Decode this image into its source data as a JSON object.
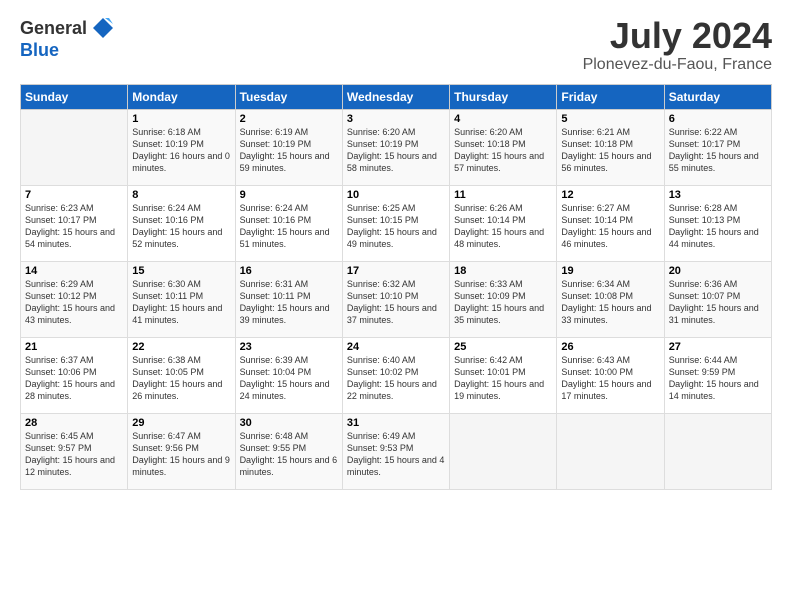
{
  "header": {
    "logo_general": "General",
    "logo_blue": "Blue",
    "month_title": "July 2024",
    "location": "Plonevez-du-Faou, France"
  },
  "days_of_week": [
    "Sunday",
    "Monday",
    "Tuesday",
    "Wednesday",
    "Thursday",
    "Friday",
    "Saturday"
  ],
  "weeks": [
    [
      {
        "num": "",
        "sunrise": "",
        "sunset": "",
        "daylight": ""
      },
      {
        "num": "1",
        "sunrise": "Sunrise: 6:18 AM",
        "sunset": "Sunset: 10:19 PM",
        "daylight": "Daylight: 16 hours and 0 minutes."
      },
      {
        "num": "2",
        "sunrise": "Sunrise: 6:19 AM",
        "sunset": "Sunset: 10:19 PM",
        "daylight": "Daylight: 15 hours and 59 minutes."
      },
      {
        "num": "3",
        "sunrise": "Sunrise: 6:20 AM",
        "sunset": "Sunset: 10:19 PM",
        "daylight": "Daylight: 15 hours and 58 minutes."
      },
      {
        "num": "4",
        "sunrise": "Sunrise: 6:20 AM",
        "sunset": "Sunset: 10:18 PM",
        "daylight": "Daylight: 15 hours and 57 minutes."
      },
      {
        "num": "5",
        "sunrise": "Sunrise: 6:21 AM",
        "sunset": "Sunset: 10:18 PM",
        "daylight": "Daylight: 15 hours and 56 minutes."
      },
      {
        "num": "6",
        "sunrise": "Sunrise: 6:22 AM",
        "sunset": "Sunset: 10:17 PM",
        "daylight": "Daylight: 15 hours and 55 minutes."
      }
    ],
    [
      {
        "num": "7",
        "sunrise": "Sunrise: 6:23 AM",
        "sunset": "Sunset: 10:17 PM",
        "daylight": "Daylight: 15 hours and 54 minutes."
      },
      {
        "num": "8",
        "sunrise": "Sunrise: 6:24 AM",
        "sunset": "Sunset: 10:16 PM",
        "daylight": "Daylight: 15 hours and 52 minutes."
      },
      {
        "num": "9",
        "sunrise": "Sunrise: 6:24 AM",
        "sunset": "Sunset: 10:16 PM",
        "daylight": "Daylight: 15 hours and 51 minutes."
      },
      {
        "num": "10",
        "sunrise": "Sunrise: 6:25 AM",
        "sunset": "Sunset: 10:15 PM",
        "daylight": "Daylight: 15 hours and 49 minutes."
      },
      {
        "num": "11",
        "sunrise": "Sunrise: 6:26 AM",
        "sunset": "Sunset: 10:14 PM",
        "daylight": "Daylight: 15 hours and 48 minutes."
      },
      {
        "num": "12",
        "sunrise": "Sunrise: 6:27 AM",
        "sunset": "Sunset: 10:14 PM",
        "daylight": "Daylight: 15 hours and 46 minutes."
      },
      {
        "num": "13",
        "sunrise": "Sunrise: 6:28 AM",
        "sunset": "Sunset: 10:13 PM",
        "daylight": "Daylight: 15 hours and 44 minutes."
      }
    ],
    [
      {
        "num": "14",
        "sunrise": "Sunrise: 6:29 AM",
        "sunset": "Sunset: 10:12 PM",
        "daylight": "Daylight: 15 hours and 43 minutes."
      },
      {
        "num": "15",
        "sunrise": "Sunrise: 6:30 AM",
        "sunset": "Sunset: 10:11 PM",
        "daylight": "Daylight: 15 hours and 41 minutes."
      },
      {
        "num": "16",
        "sunrise": "Sunrise: 6:31 AM",
        "sunset": "Sunset: 10:11 PM",
        "daylight": "Daylight: 15 hours and 39 minutes."
      },
      {
        "num": "17",
        "sunrise": "Sunrise: 6:32 AM",
        "sunset": "Sunset: 10:10 PM",
        "daylight": "Daylight: 15 hours and 37 minutes."
      },
      {
        "num": "18",
        "sunrise": "Sunrise: 6:33 AM",
        "sunset": "Sunset: 10:09 PM",
        "daylight": "Daylight: 15 hours and 35 minutes."
      },
      {
        "num": "19",
        "sunrise": "Sunrise: 6:34 AM",
        "sunset": "Sunset: 10:08 PM",
        "daylight": "Daylight: 15 hours and 33 minutes."
      },
      {
        "num": "20",
        "sunrise": "Sunrise: 6:36 AM",
        "sunset": "Sunset: 10:07 PM",
        "daylight": "Daylight: 15 hours and 31 minutes."
      }
    ],
    [
      {
        "num": "21",
        "sunrise": "Sunrise: 6:37 AM",
        "sunset": "Sunset: 10:06 PM",
        "daylight": "Daylight: 15 hours and 28 minutes."
      },
      {
        "num": "22",
        "sunrise": "Sunrise: 6:38 AM",
        "sunset": "Sunset: 10:05 PM",
        "daylight": "Daylight: 15 hours and 26 minutes."
      },
      {
        "num": "23",
        "sunrise": "Sunrise: 6:39 AM",
        "sunset": "Sunset: 10:04 PM",
        "daylight": "Daylight: 15 hours and 24 minutes."
      },
      {
        "num": "24",
        "sunrise": "Sunrise: 6:40 AM",
        "sunset": "Sunset: 10:02 PM",
        "daylight": "Daylight: 15 hours and 22 minutes."
      },
      {
        "num": "25",
        "sunrise": "Sunrise: 6:42 AM",
        "sunset": "Sunset: 10:01 PM",
        "daylight": "Daylight: 15 hours and 19 minutes."
      },
      {
        "num": "26",
        "sunrise": "Sunrise: 6:43 AM",
        "sunset": "Sunset: 10:00 PM",
        "daylight": "Daylight: 15 hours and 17 minutes."
      },
      {
        "num": "27",
        "sunrise": "Sunrise: 6:44 AM",
        "sunset": "Sunset: 9:59 PM",
        "daylight": "Daylight: 15 hours and 14 minutes."
      }
    ],
    [
      {
        "num": "28",
        "sunrise": "Sunrise: 6:45 AM",
        "sunset": "Sunset: 9:57 PM",
        "daylight": "Daylight: 15 hours and 12 minutes."
      },
      {
        "num": "29",
        "sunrise": "Sunrise: 6:47 AM",
        "sunset": "Sunset: 9:56 PM",
        "daylight": "Daylight: 15 hours and 9 minutes."
      },
      {
        "num": "30",
        "sunrise": "Sunrise: 6:48 AM",
        "sunset": "Sunset: 9:55 PM",
        "daylight": "Daylight: 15 hours and 6 minutes."
      },
      {
        "num": "31",
        "sunrise": "Sunrise: 6:49 AM",
        "sunset": "Sunset: 9:53 PM",
        "daylight": "Daylight: 15 hours and 4 minutes."
      },
      {
        "num": "",
        "sunrise": "",
        "sunset": "",
        "daylight": ""
      },
      {
        "num": "",
        "sunrise": "",
        "sunset": "",
        "daylight": ""
      },
      {
        "num": "",
        "sunrise": "",
        "sunset": "",
        "daylight": ""
      }
    ]
  ]
}
